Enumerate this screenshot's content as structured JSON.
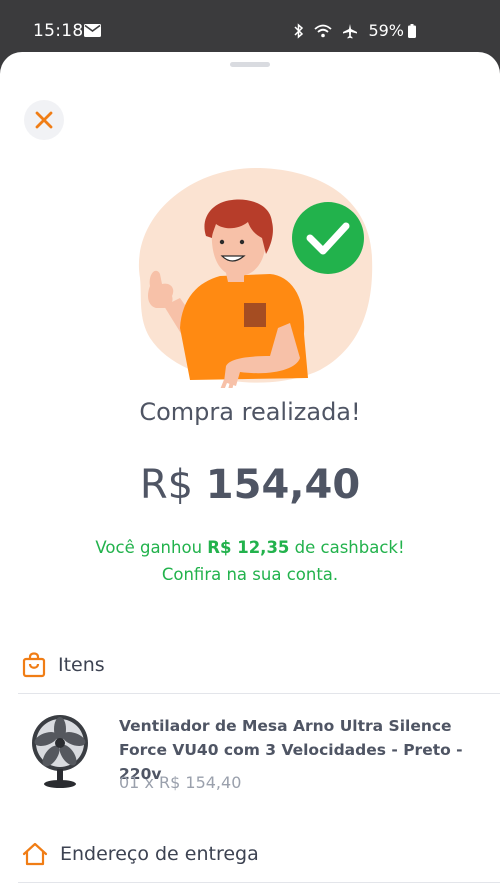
{
  "status_bar": {
    "time": "15:18",
    "battery": "59%",
    "icons": [
      "mail-icon",
      "bluetooth-icon",
      "wifi-icon",
      "airplane-icon",
      "battery-icon"
    ]
  },
  "sheet": {
    "close_icon": "close-icon",
    "accent_color": "#f07d15",
    "success_color": "#22b24c"
  },
  "confirmation": {
    "title": "Compra realizada!",
    "currency": "R$",
    "amount": "154,40",
    "cashback_prefix": "Você ganhou ",
    "cashback_value": "R$ 12,35",
    "cashback_suffix": " de cashback!",
    "cashback_line2": "Confira na sua conta."
  },
  "items_section": {
    "title": "Itens",
    "icon": "shopping-bag-icon",
    "items": [
      {
        "name": "Ventilador de Mesa Arno Ultra Silence Force VU40 com 3 Velocidades - Preto - 220v",
        "quantity_price": "01 x R$ 154,40"
      }
    ]
  },
  "address_section": {
    "title": "Endereço de entrega",
    "icon": "home-icon"
  }
}
